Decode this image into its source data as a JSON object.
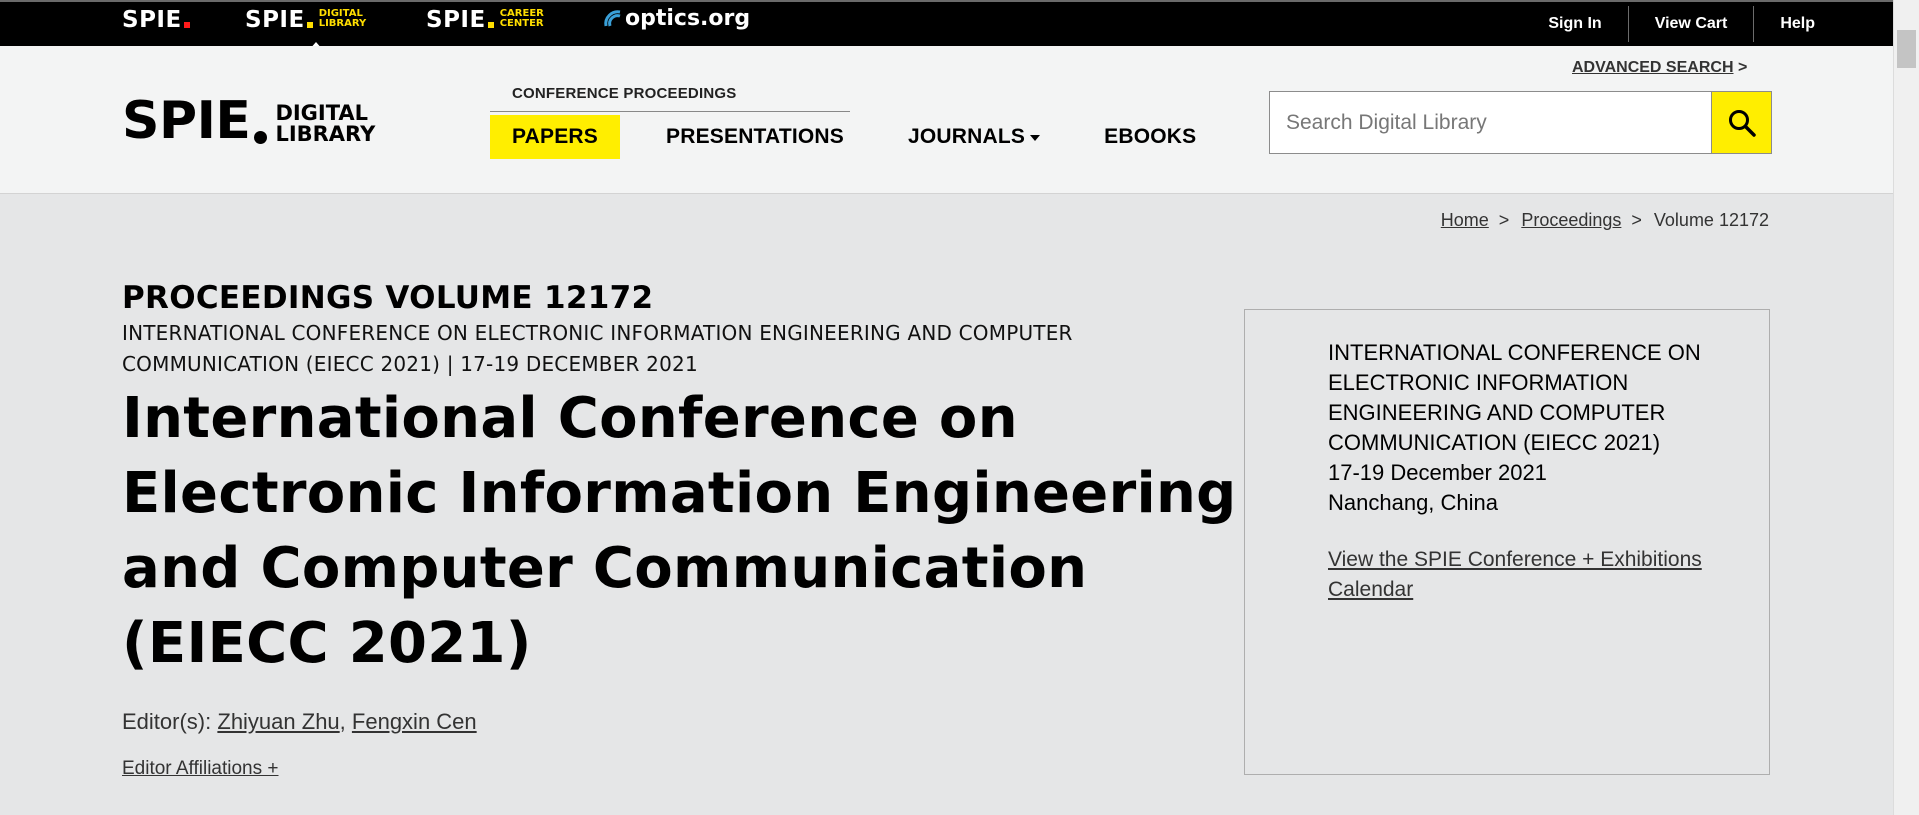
{
  "topbar": {
    "brands": {
      "spie": "SPIE",
      "digital_library": {
        "main": "SPIE",
        "sub1": "DIGITAL",
        "sub2": "LIBRARY"
      },
      "career_center": {
        "main": "SPIE",
        "sub1": "CAREER",
        "sub2": "CENTER"
      },
      "optics": "optics.org"
    },
    "links": [
      "Sign In",
      "View Cart",
      "Help"
    ]
  },
  "header": {
    "logo": {
      "main": "SPIE",
      "line1": "DIGITAL",
      "line2": "LIBRARY"
    },
    "nav_label": "CONFERENCE PROCEEDINGS",
    "nav": [
      "PAPERS",
      "PRESENTATIONS",
      "JOURNALS",
      "EBOOKS"
    ],
    "advanced_search": "ADVANCED SEARCH",
    "advanced_search_arrow": ">",
    "search_placeholder": "Search Digital Library"
  },
  "breadcrumb": {
    "home": "Home",
    "proceedings": "Proceedings",
    "current": "Volume 12172",
    "sep": ">"
  },
  "main": {
    "volume_title": "PROCEEDINGS VOLUME 12172",
    "subtitle": "INTERNATIONAL CONFERENCE ON ELECTRONIC INFORMATION ENGINEERING AND COMPUTER COMMUNICATION (EIECC 2021) | 17-19 DECEMBER 2021",
    "title": "International Conference on Electronic Information Engineering and Computer Communication (EIECC 2021)",
    "editors_label": "Editor(s):",
    "editors": [
      "Zhiyuan Zhu",
      "Fengxin Cen"
    ],
    "editor_affiliations": "Editor Affiliations +"
  },
  "info_box": {
    "conference": "INTERNATIONAL CONFERENCE ON ELECTRONIC INFORMATION ENGINEERING AND COMPUTER COMMUNICATION (EIECC 2021)",
    "dates": "17-19 December 2021",
    "location": "Nanchang, China",
    "calendar_link": "View the SPIE Conference + Exhibitions Calendar"
  },
  "colors": {
    "accent_yellow": "#ffee00",
    "topbar": "#000000",
    "header_bg": "#f3f4f4",
    "page_bg": "#e5e6e7"
  },
  "icons": {
    "search": "search-icon",
    "optics_logo": "optics-signal-icon"
  }
}
